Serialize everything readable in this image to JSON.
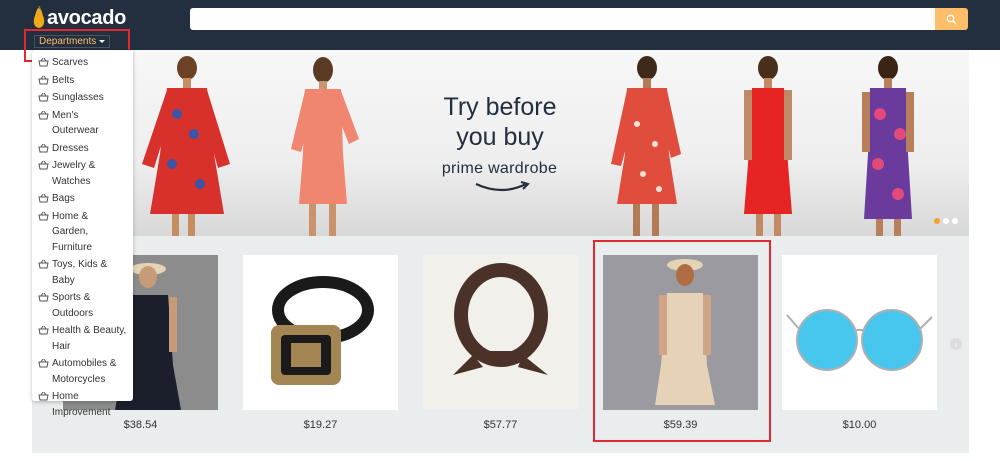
{
  "header": {
    "logo_text": "avocado",
    "search_value": "",
    "departments_label": "Departments"
  },
  "hero": {
    "title": "Try before you buy",
    "brand": "prime wardrobe",
    "carousel_dots": 3,
    "active_dot": 0
  },
  "departments": [
    {
      "label": "Scarves"
    },
    {
      "label": "Belts"
    },
    {
      "label": "Sunglasses"
    },
    {
      "label": "Men's Outerwear"
    },
    {
      "label": "Dresses"
    },
    {
      "label": "Jewelry & Watches"
    },
    {
      "label": "Bags"
    },
    {
      "label": "Home & Garden, Furniture"
    },
    {
      "label": "Toys, Kids & Baby"
    },
    {
      "label": "Sports & Outdoors"
    },
    {
      "label": "Health & Beauty, Hair"
    },
    {
      "label": "Automobiles & Motorcycles"
    },
    {
      "label": "Home Improvement"
    }
  ],
  "products": [
    {
      "name": "black-dress",
      "price": "$38.54"
    },
    {
      "name": "leather-belt",
      "price": "$19.27"
    },
    {
      "name": "silk-scarf",
      "price": "$57.77"
    },
    {
      "name": "beige-dress",
      "price": "$59.39"
    },
    {
      "name": "round-sunglasses",
      "price": "$10.00"
    }
  ],
  "colors": {
    "topbar": "#232f3e",
    "accent": "#febd69",
    "highlight": "#e0282f",
    "strip": "#eaeded"
  },
  "icons": {
    "logo": "avocado-icon",
    "search": "search-icon",
    "dropdown_caret": "caret-down-icon",
    "department_item": "basket-icon",
    "carousel_next": "chevron-right-icon"
  }
}
